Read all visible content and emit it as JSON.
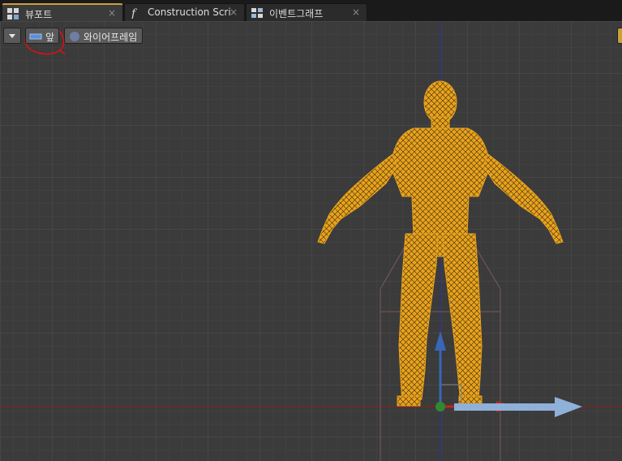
{
  "tabs": [
    {
      "label": "뷰포트",
      "icon": "viewport-icon",
      "close": "×",
      "active": true
    },
    {
      "label": "Construction Scrip",
      "icon": "function-icon",
      "close": "×",
      "active": false
    },
    {
      "label": "이벤트그래프",
      "icon": "event-graph-icon",
      "close": "×",
      "active": false
    }
  ],
  "toolbar": {
    "menu_icon": "chevron-down-icon",
    "view_mode_label": "앞",
    "view_mode_icon": "front-view-icon",
    "render_mode_label": "와이어프레임",
    "render_mode_icon": "wireframe-icon"
  },
  "colors": {
    "mesh": "#e8a21e",
    "gizmo_z": "#3a66b8",
    "gizmo_x": "#c0261d",
    "gizmo_arrow": "#8fb0d8",
    "axis_z_line": "#2b2ba8",
    "axis_x_line": "#8a1f1f",
    "pivot": "#2f8a2f",
    "annotation": "#e01010",
    "active_tab_accent": "#c9a13a"
  }
}
